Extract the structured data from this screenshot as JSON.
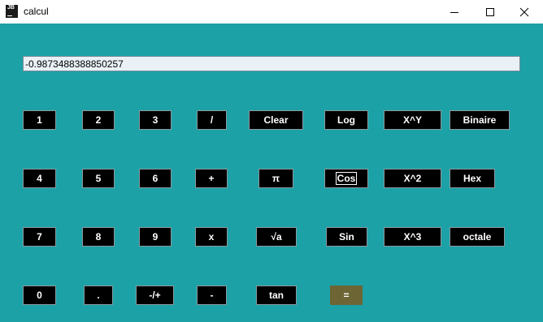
{
  "window": {
    "title": "calcul",
    "app_icon_text": "JB"
  },
  "display": {
    "value": "-0.9873488388850257"
  },
  "buttons": {
    "one": "1",
    "two": "2",
    "three": "3",
    "divide": "/",
    "clear": "Clear",
    "log": "Log",
    "pow_xy": "X^Y",
    "binaire": "Binaire",
    "four": "4",
    "five": "5",
    "six": "6",
    "plus": "+",
    "pi": "π",
    "cos": "Cos",
    "square": "X^2",
    "hex": "Hex",
    "seven": "7",
    "eight": "8",
    "nine": "9",
    "multiply": "x",
    "sqrt": "√a",
    "sin": "Sin",
    "cube": "X^3",
    "octale": "octale",
    "zero": "0",
    "dot": ".",
    "negate": "-/+",
    "minus": "-",
    "tan": "tan",
    "equals": "="
  },
  "colors": {
    "background": "#1ca1a6",
    "button": "#000000",
    "equals_button": "#6e6535"
  }
}
